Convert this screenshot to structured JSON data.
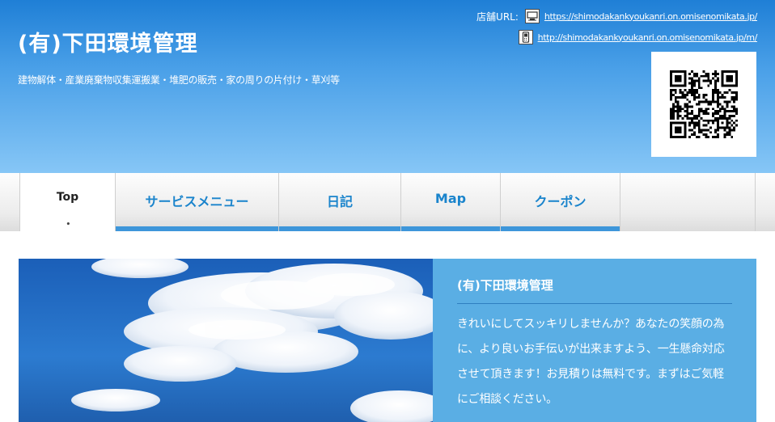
{
  "header": {
    "title": "(有)下田環境管理",
    "tagline": "建物解体・産業廃棄物収集運搬業・堆肥の販売・家の周りの片付け・草刈等",
    "url_label": "店舗URL:",
    "pc_url": "https://shimodakankyoukanri.on.omisenomikata.jp/",
    "mobile_url": "http://shimodakankyoukanri.on.omisenomikata.jp/m/",
    "pc_icon": "monitor-icon",
    "mobile_icon": "mobile-phone-icon",
    "qr_icon": "qr-code"
  },
  "nav": {
    "items": [
      {
        "label": "Top",
        "active": true
      },
      {
        "label": "サービスメニュー",
        "active": false
      },
      {
        "label": "日記",
        "active": false
      },
      {
        "label": "Map",
        "active": false
      },
      {
        "label": "クーポン",
        "active": false
      }
    ],
    "active_marker": "•"
  },
  "hero": {
    "heading": "(有)下田環境管理",
    "body": "きれいにしてスッキリしませんか？あなたの笑顔の為に、より良いお手伝いが出来ますよう、一生懸命対応させて頂きます！お見積りは無料です。まずはご気軽にご相談ください。"
  },
  "colors": {
    "header_top": "#1f7fd6",
    "header_bottom": "#86c6f6",
    "nav_accent": "#3e96da",
    "nav_text": "#1a84cc",
    "hero_panel": "#5aaee4"
  }
}
